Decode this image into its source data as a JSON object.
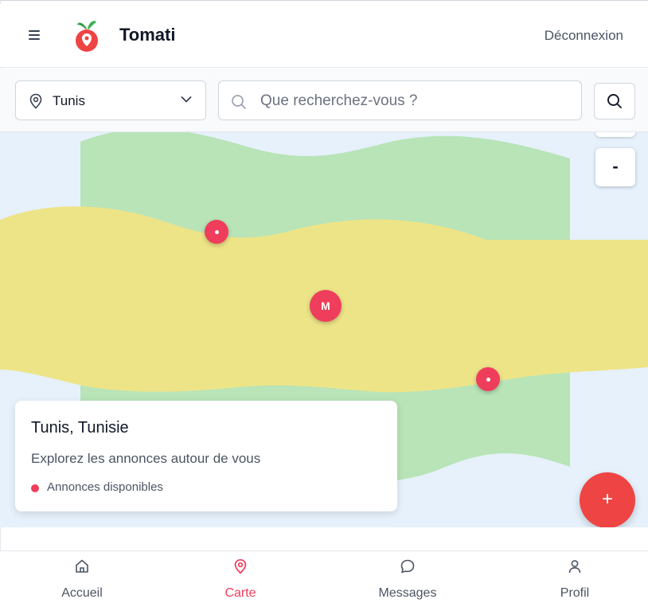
{
  "header": {
    "app_name": "Tomati",
    "logout_label": "Déconnexion"
  },
  "search": {
    "city_value": "Tunis",
    "placeholder": "Que recherchez-vous ?"
  },
  "map": {
    "zoom_in_label": "+",
    "zoom_out_label": "-",
    "cluster_marker_label": "M",
    "info_card": {
      "title": "Tunis, Tunisie",
      "subtitle": "Explorez les annonces autour de vous",
      "status": "Annonces disponibles"
    },
    "fab_label": "+"
  },
  "bottom_nav": {
    "items": [
      {
        "label": "Accueil",
        "icon": "home-icon"
      },
      {
        "label": "Carte",
        "icon": "map-pin-icon",
        "active": true
      },
      {
        "label": "Messages",
        "icon": "chat-icon"
      },
      {
        "label": "Profil",
        "icon": "user-icon"
      }
    ]
  },
  "colors": {
    "accent": "#ef3d5c",
    "fab": "#ef4444",
    "map_water": "#e6f1fb",
    "map_green": "#b8e4b8",
    "map_yellow": "#ede488"
  }
}
